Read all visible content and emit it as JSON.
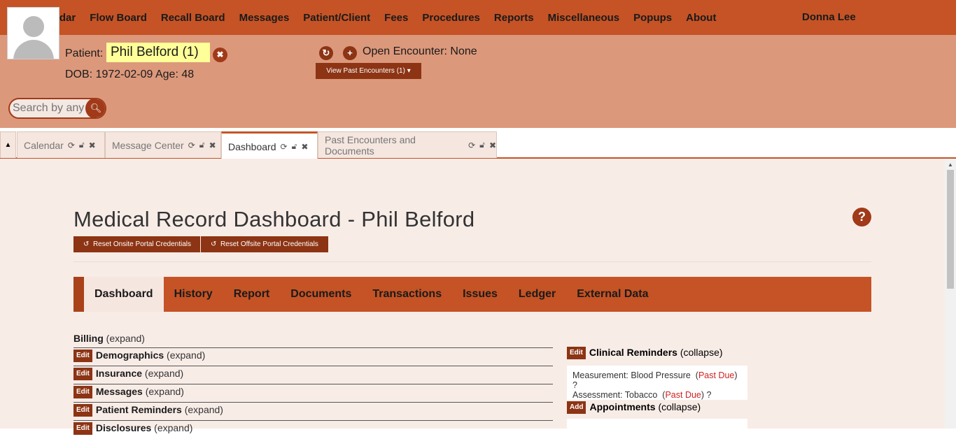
{
  "topnav": {
    "menu": [
      "Calendar",
      "Flow Board",
      "Recall Board",
      "Messages",
      "Patient/Client",
      "Fees",
      "Procedures",
      "Reports",
      "Miscellaneous",
      "Popups",
      "About"
    ],
    "user": "Donna Lee"
  },
  "patient": {
    "label": "Patient:",
    "name": "Phil Belford (1)",
    "dob": "DOB: 1972-02-09 Age: 48",
    "search_placeholder": "Search by any"
  },
  "encounter": {
    "text": "Open Encounter: None",
    "past_button": "View Past Encounters  (1) ▾"
  },
  "tabs": [
    {
      "label": "Calendar"
    },
    {
      "label": "Message Center"
    },
    {
      "label": "Dashboard"
    },
    {
      "label": "Past Encounters and Documents"
    }
  ],
  "dashboard": {
    "title": "Medical Record Dashboard - Phil Belford",
    "reset_onsite": "Reset Onsite Portal Credentials",
    "reset_offsite": "Reset Offsite Portal Credentials",
    "subnav": [
      "Dashboard",
      "History",
      "Report",
      "Documents",
      "Transactions",
      "Issues",
      "Ledger",
      "External Data"
    ],
    "sections": [
      {
        "title": "Billing",
        "state": "(expand)"
      },
      {
        "title": "Demographics",
        "state": "(expand)",
        "btn": "Edit"
      },
      {
        "title": "Insurance",
        "state": "(expand)",
        "btn": "Edit"
      },
      {
        "title": "Messages",
        "state": "(expand)",
        "btn": "Edit"
      },
      {
        "title": "Patient Reminders",
        "state": "(expand)",
        "btn": "Edit"
      },
      {
        "title": "Disclosures",
        "state": "(expand)",
        "btn": "Edit"
      }
    ],
    "clinical_reminders": {
      "btn": "Edit",
      "title": "Clinical Reminders",
      "state": "(collapse)",
      "items": [
        {
          "text": "Measurement: Blood Pressure",
          "status": "Past Due"
        },
        {
          "text": "Assessment: Tobacco",
          "status": "Past Due"
        }
      ]
    },
    "appointments": {
      "btn": "Add",
      "title": "Appointments",
      "state": "(collapse)"
    }
  }
}
